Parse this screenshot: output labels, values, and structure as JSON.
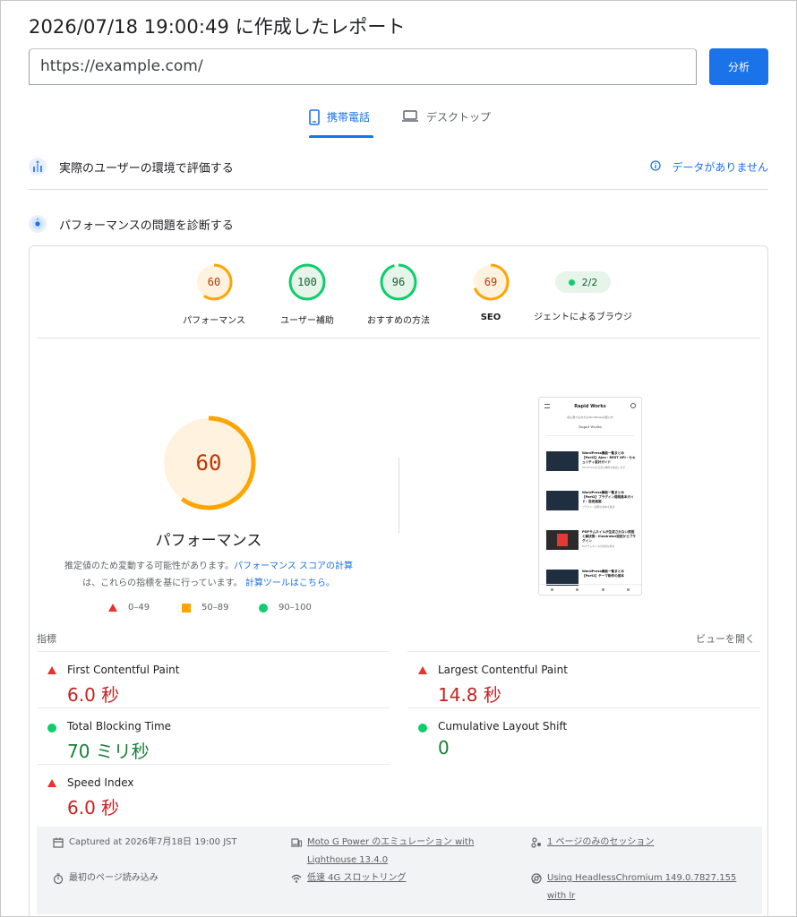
{
  "header": {
    "title": "2026/07/18 19:00:49 に作成したレポート"
  },
  "search": {
    "url_value": "https://example.com/",
    "analyze_label": "分析"
  },
  "tabs": [
    {
      "label": "携帯電話",
      "active": true,
      "icon": "smartphone-icon"
    },
    {
      "label": "デスクトップ",
      "active": false,
      "icon": "laptop-icon"
    }
  ],
  "field_section": {
    "title": "実際のユーザーの環境で評価する",
    "no_data": "データがありません",
    "icon": "users-chart-icon"
  },
  "lab_section": {
    "title": "パフォーマンスの問題を診断する",
    "icon": "lighthouse-icon"
  },
  "categories": [
    {
      "label": "パフォーマンス",
      "score": "60",
      "status": "average"
    },
    {
      "label": "ユーザー補助",
      "score": "100",
      "status": "pass"
    },
    {
      "label": "おすすめの方法",
      "score": "96",
      "status": "pass"
    },
    {
      "label": "SEO",
      "score": "69",
      "status": "average"
    },
    {
      "label": "ジェントによるブラウジ",
      "score": "2/2",
      "status": "pass"
    }
  ],
  "performance": {
    "score": "60",
    "title": "パフォーマンス",
    "note_before": "推定値のため変動する可能性があります。",
    "note_link1": "パフォーマンス スコアの計算",
    "note_mid": "は、これらの指標を基に行っています。",
    "note_link2": "計算ツールはこちら。"
  },
  "legend": [
    {
      "range": "0–49",
      "status": "fail",
      "color": "#e8332d"
    },
    {
      "range": "50–89",
      "status": "average",
      "color": "#ffa400"
    },
    {
      "range": "90–100",
      "status": "pass",
      "color": "#0cce6b"
    }
  ],
  "screenshot": {
    "site_name": "Rapid Works",
    "subtitle": "初心者でもわかるWordPressの使い方",
    "brand": "Rapid Works",
    "posts": [
      {
        "title": "WordPress機能一覧まとめ【Part3】Ajax・REST API・セキュリティ設計ガイド",
        "desc": "WordPressの高度な機能を解説します"
      },
      {
        "title": "WordPress機能一覧まとめ【Part2】プラグイン開発基本ガイド：設定画面",
        "desc": "プラグイン開発の基本を解説"
      },
      {
        "title": "PDFサムネイルが生成されない原因と解決策：Illustrator設定からプラグイン",
        "desc": "PDFサムネイルの問題を解決"
      },
      {
        "title": "WordPress機能一覧まとめ【Part1】テーマ制作の基本",
        "desc": "テーマ制作の基本を解説"
      }
    ]
  },
  "metrics_section": {
    "label": "指標",
    "toggle": "ビューを開く"
  },
  "metrics": [
    {
      "name": "First Contentful Paint",
      "value": "6.0 秒",
      "status": "fail"
    },
    {
      "name": "Largest Contentful Paint",
      "value": "14.8 秒",
      "status": "fail"
    },
    {
      "name": "Total Blocking Time",
      "value": "70 ミリ秒",
      "status": "pass"
    },
    {
      "name": "Cumulative Layout Shift",
      "value": "0",
      "status": "pass"
    },
    {
      "name": "Speed Index",
      "value": "6.0 秒",
      "status": "fail"
    }
  ],
  "footer": {
    "captured": "Captured at 2026年7月18日 19:00 JST",
    "device": "Moto G Power のエミュレーション with Lighthouse 13.4.0",
    "session": "1 ページのみのセッション",
    "load": "最初のページ読み込み",
    "throttling": "低速 4G スロットリング",
    "browser": "Using HeadlessChromium 149.0.7827.155 with lr"
  },
  "colors": {
    "accent": "#1a73e8",
    "fail": "#e8332d",
    "average": "#ffa400",
    "pass": "#0cce6b"
  }
}
